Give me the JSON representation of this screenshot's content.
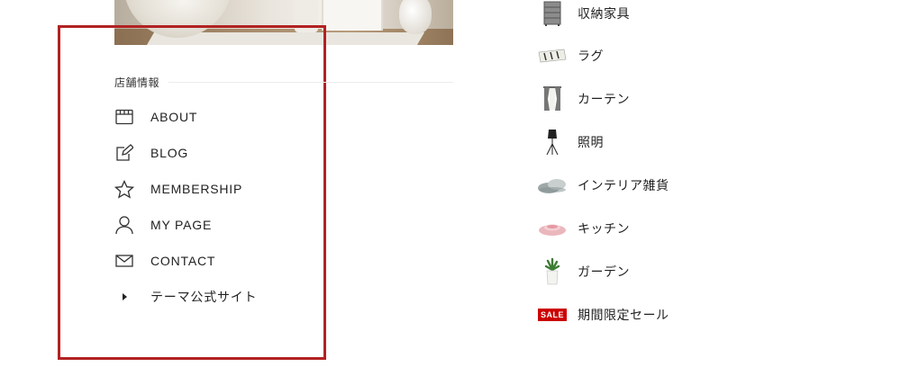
{
  "store_info": {
    "heading": "店舗情報",
    "items": [
      {
        "label": "ABOUT",
        "icon": "storefront-icon"
      },
      {
        "label": "BLOG",
        "icon": "edit-icon"
      },
      {
        "label": "MEMBERSHIP",
        "icon": "star-icon"
      },
      {
        "label": "MY PAGE",
        "icon": "user-icon"
      },
      {
        "label": "CONTACT",
        "icon": "mail-icon"
      },
      {
        "label": "テーマ公式サイト",
        "icon": "caret-right-icon"
      }
    ]
  },
  "categories": {
    "items": [
      {
        "label": "収納家具",
        "icon": "drawer-chest-icon"
      },
      {
        "label": "ラグ",
        "icon": "rug-icon"
      },
      {
        "label": "カーテン",
        "icon": "curtain-icon"
      },
      {
        "label": "照明",
        "icon": "floor-lamp-icon"
      },
      {
        "label": "インテリア雑貨",
        "icon": "cushion-icon"
      },
      {
        "label": "キッチン",
        "icon": "plate-icon"
      },
      {
        "label": "ガーデン",
        "icon": "plant-pot-icon"
      },
      {
        "label": "期間限定セール",
        "icon": "sale-badge-icon",
        "badge": "SALE"
      }
    ]
  },
  "colors": {
    "highlight": "#b22222",
    "sale": "#cc0000",
    "text": "#222222"
  }
}
